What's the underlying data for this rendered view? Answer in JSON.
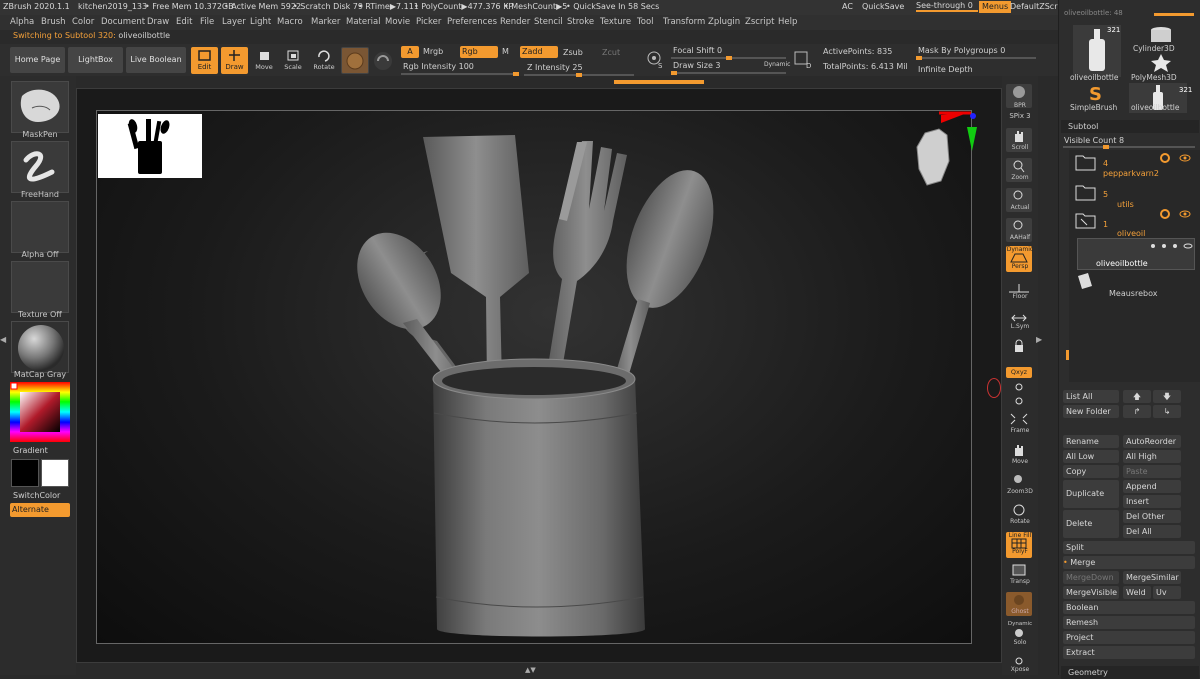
{
  "title_bar": {
    "app": "ZBrush 2020.1.1",
    "project": "kitchen2019_133",
    "free_mem": "• Free Mem 10.372GB",
    "active_mem": "• Active Mem 5922",
    "scratch": "• Scratch Disk 79",
    "rtime": "• RTime▶7.111",
    "polycount": "• PolyCount▶477.376 KP",
    "meshcount": "• MeshCount▶5",
    "quicksave": "• QuickSave In 58 Secs",
    "ac": "AC",
    "quicksave_btn": "QuickSave",
    "seethrough": "See-through  0",
    "menus": "Menus",
    "defaultzscript": "DefaultZScript"
  },
  "menu": [
    "Alpha",
    "Brush",
    "Color",
    "Document",
    "Draw",
    "Edit",
    "File",
    "Layer",
    "Light",
    "Macro",
    "Marker",
    "Material",
    "Movie",
    "Picker",
    "Preferences",
    "Render",
    "Stencil",
    "Stroke",
    "Texture",
    "Tool",
    "Transform",
    "Zplugin",
    "Zscript",
    "Help"
  ],
  "status": {
    "prefix": "Switching to Subtool 320:",
    "name": "oliveoilbottle"
  },
  "shelf": {
    "home_page": "Home Page",
    "lightbox": "LightBox",
    "live_boolean": "Live Boolean",
    "edit": "Edit",
    "draw": "Draw",
    "move": "Move",
    "scale": "Scale",
    "rotate": "Rotate",
    "a": "A",
    "mrgb": "Mrgb",
    "rgb": "Rgb",
    "m": "M",
    "rgb_intensity": "Rgb Intensity 100",
    "zadd": "Zadd",
    "zsub": "Zsub",
    "zcut": "Zcut",
    "z_intensity": "Z Intensity 25",
    "focal_shift": "Focal Shift 0",
    "draw_size": "Draw Size 3",
    "dynamic": "Dynamic",
    "active_points": "ActivePoints: 835",
    "total_points": "TotalPoints: 6.413 Mil",
    "mask_by_polygroups": "Mask By Polygroups 0",
    "infinite_depth": "Infinite Depth",
    "s_icon": "S",
    "d_icon": "D"
  },
  "left_shelf": {
    "maskpen": "MaskPen",
    "freehand": "FreeHand",
    "alpha_off": "Alpha Off",
    "texture_off": "Texture Off",
    "matcap": "MatCap Gray",
    "gradient": "Gradient",
    "switchcolor": "SwitchColor",
    "alternate": "Alternate"
  },
  "right_shelf": {
    "bpr": "BPR",
    "spix": "SPix 3",
    "scroll": "Scroll",
    "zoom": "Zoom",
    "actual": "Actual",
    "aahalf": "AAHalf",
    "dynamic": "Dynamic",
    "persp": "Persp",
    "floor": "Floor",
    "lsym": "L.Sym",
    "xyz": "Qxyz",
    "frame": "Frame",
    "move": "Move",
    "zoom3d": "Zoom3D",
    "rotate": "Rotate",
    "linefill": "Line Fill",
    "polyf": "PolyF",
    "transp": "Transp",
    "ghost": "Ghost",
    "dynamic2": "Dynamic",
    "solo": "Solo",
    "xpose": "Xpose"
  },
  "tool_panel": {
    "top_cut": "oliveoilbottle: 48",
    "thumbs": [
      {
        "label": "oliveoilbottle",
        "badge": "321"
      },
      {
        "label": "Cylinder3D",
        "badge": ""
      },
      {
        "label": "PolyMesh3D",
        "badge": ""
      },
      {
        "label": "SimpleBrush",
        "badge": ""
      },
      {
        "label": "oliveoilbottle",
        "badge": "321"
      }
    ],
    "subtool_header": "Subtool",
    "visible_count": "Visible Count 8",
    "subtools": [
      {
        "count": "4",
        "name": "pepparkvarn2"
      },
      {
        "count": "5",
        "name": "utils"
      },
      {
        "count": "1",
        "name": "oliveoil"
      },
      {
        "count": "",
        "name": "oliveoilbottle"
      },
      {
        "count": "",
        "name": "Meausrebox"
      }
    ],
    "buttons": {
      "list_all": "List All",
      "new_folder": "New Folder",
      "rename": "Rename",
      "autoreorder": "AutoReorder",
      "all_low": "All Low",
      "all_high": "All High",
      "copy": "Copy",
      "paste": "Paste",
      "duplicate": "Duplicate",
      "append": "Append",
      "insert": "Insert",
      "delete": "Delete",
      "del_other": "Del Other",
      "del_all": "Del All",
      "split": "Split",
      "merge": "Merge",
      "mergedown": "MergeDown",
      "mergesimilar": "MergeSimilar",
      "mergevisible": "MergeVisible",
      "weld": "Weld",
      "uv": "Uv",
      "boolean": "Boolean",
      "remesh": "Remesh",
      "project": "Project",
      "extract": "Extract",
      "geometry": "Geometry"
    }
  },
  "colors": {
    "accent": "#f39a2f",
    "bg": "#2a2a2a"
  }
}
